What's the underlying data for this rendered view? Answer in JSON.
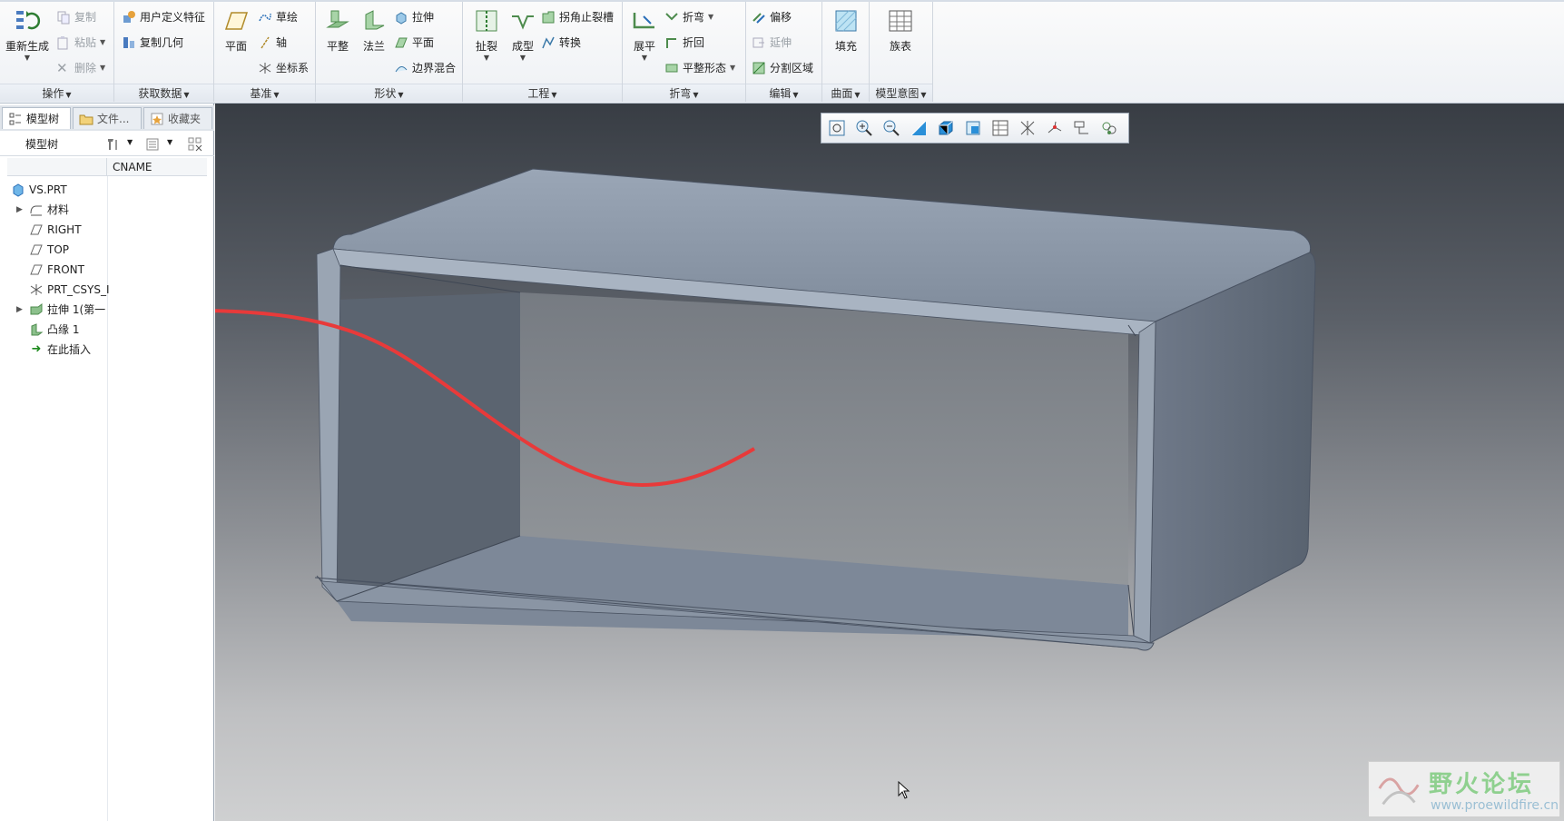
{
  "ribbon": {
    "groups": [
      {
        "label": "操作",
        "items": {
          "regen": "重新生成",
          "copy": "复制",
          "paste": "粘贴",
          "delete": "删除"
        }
      },
      {
        "label": "获取数据",
        "items": {
          "udf": "用户定义特征",
          "copy_geom": "复制几何"
        }
      },
      {
        "label": "基准",
        "items": {
          "plane": "平面",
          "sketch": "草绘",
          "axis": "轴",
          "csys": "坐标系"
        }
      },
      {
        "label": "形状",
        "items": {
          "flat": "平整",
          "flange": "法兰",
          "extrude": "拉伸",
          "plane": "平面",
          "blend": "边界混合"
        }
      },
      {
        "label": "工程",
        "items": {
          "rip": "扯裂",
          "form": "成型",
          "corner_relief": "拐角止裂槽",
          "convert": "转换"
        }
      },
      {
        "label": "折弯",
        "items": {
          "unbend": "展平",
          "bend": "折弯",
          "bend_back": "折回",
          "flat_state": "平整形态"
        }
      },
      {
        "label": "编辑",
        "items": {
          "offset": "偏移",
          "extend": "延伸",
          "split_area": "分割区域"
        }
      },
      {
        "label": "曲面",
        "items": {
          "fill": "填充"
        }
      },
      {
        "label": "模型意图",
        "items": {
          "family_table": "族表"
        }
      }
    ]
  },
  "left_panel": {
    "tabs": [
      "模型树",
      "文件...",
      "收藏夹"
    ],
    "toolbar_title": "模型树",
    "column_header": "CNAME",
    "tree": [
      {
        "label": "VS.PRT",
        "icon": "part-icon",
        "expand": ""
      },
      {
        "label": "材料",
        "icon": "material-icon",
        "expand": "▶"
      },
      {
        "label": "RIGHT",
        "icon": "datum-plane-icon",
        "expand": ""
      },
      {
        "label": "TOP",
        "icon": "datum-plane-icon",
        "expand": ""
      },
      {
        "label": "FRONT",
        "icon": "datum-plane-icon",
        "expand": ""
      },
      {
        "label": "PRT_CSYS_I",
        "icon": "csys-icon",
        "expand": ""
      },
      {
        "label": "拉伸 1(第一",
        "icon": "extrude-wall-icon",
        "expand": "▶"
      },
      {
        "label": "凸缘 1",
        "icon": "flange-icon",
        "expand": ""
      },
      {
        "label": "在此插入",
        "icon": "insert-here-icon",
        "expand": ""
      }
    ]
  },
  "viewport": {
    "toolbar_icons": [
      "refit-icon",
      "zoom-in-icon",
      "zoom-out-icon",
      "repaint-icon",
      "display-style-icon",
      "saved-views-icon",
      "view-manager-icon",
      "datum-display-icon",
      "spin-center-icon",
      "annotation-display-icon",
      "appearance-icon"
    ],
    "watermark_title": "野火论坛",
    "watermark_url": "www.proewildfire.cn"
  },
  "colors": {
    "annotation_arrow": "#e83a3a",
    "model_face": "#8793a3",
    "ribbon_bg": "#f6f8fa"
  }
}
